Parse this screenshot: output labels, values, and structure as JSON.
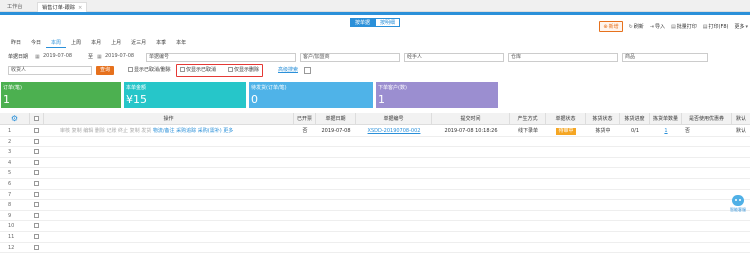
{
  "tabs": [
    {
      "label": "工作台"
    },
    {
      "label": "销售订单-跟踪",
      "close": "×"
    }
  ],
  "view_tabs": [
    "按单据",
    "按明细"
  ],
  "toolbar": {
    "new_label": "新增",
    "refresh_label": "刷新",
    "import_label": "导入",
    "batch_print_label": "批量打印",
    "print_label": "打印(F8)",
    "more_label": "更多"
  },
  "date_ranges": [
    "昨日",
    "今日",
    "本周",
    "上周",
    "本月",
    "上月",
    "近三月",
    "本季",
    "本年"
  ],
  "active_range": "本周",
  "filters": {
    "date_label": "单据日期",
    "date_start": "2019-07-08",
    "date_to": "至",
    "date_end": "2019-07-08",
    "doc_no_placeholder": "单据编号",
    "customer_placeholder": "客户/加盟商",
    "handler_placeholder": "经手人",
    "warehouse_placeholder": "仓库",
    "product_placeholder": "商品",
    "receiver_placeholder": "收货人",
    "query_label": "查询",
    "show_cancelled_label": "显示已取消/删除",
    "only_cancelled_label": "仅显示已取消",
    "only_deleted_label": "仅显示删除",
    "advanced_label": "高级搜索"
  },
  "cards": [
    {
      "label": "订单(笔)",
      "value": "1",
      "color": "#4cb050"
    },
    {
      "label": "本单金额",
      "value": "¥15",
      "color": "#26c6c9"
    },
    {
      "label": "待发货(订单/笔)",
      "value": "0",
      "color": "#4fb3e8"
    },
    {
      "label": "下单客户(数)",
      "value": "1",
      "color": "#9b8ed0"
    }
  ],
  "table": {
    "headers": [
      "操作",
      "已开票",
      "单据日期",
      "单据编号",
      "提交时间",
      "产生方式",
      "单据状态",
      "拣货状态",
      "拣货进度",
      "拣货单数量",
      "是否使用优惠券",
      "默认"
    ],
    "row_numbers": [
      "1",
      "2",
      "3",
      "4",
      "5",
      "6",
      "7",
      "8",
      "9",
      "10",
      "11",
      "12"
    ],
    "row1": {
      "ops": [
        "审核",
        "复制",
        "编辑",
        "删除",
        "记账",
        "终止",
        "复制",
        "发货"
      ],
      "ops_links": [
        "物流/备注",
        "采购追踪",
        "采购(需补)",
        "更多"
      ],
      "invoiced": "否",
      "date": "2019-07-08",
      "doc_no": "XSDD-20190708-002",
      "submit_time": "2019-07-08 10:18:26",
      "source": "线下录单",
      "status": "待审中",
      "pick_status": "拣货中",
      "pick_progress": "0/1",
      "pick_count": "1",
      "coupon": "否",
      "default": "默认"
    }
  },
  "robot_label": "智能客服"
}
